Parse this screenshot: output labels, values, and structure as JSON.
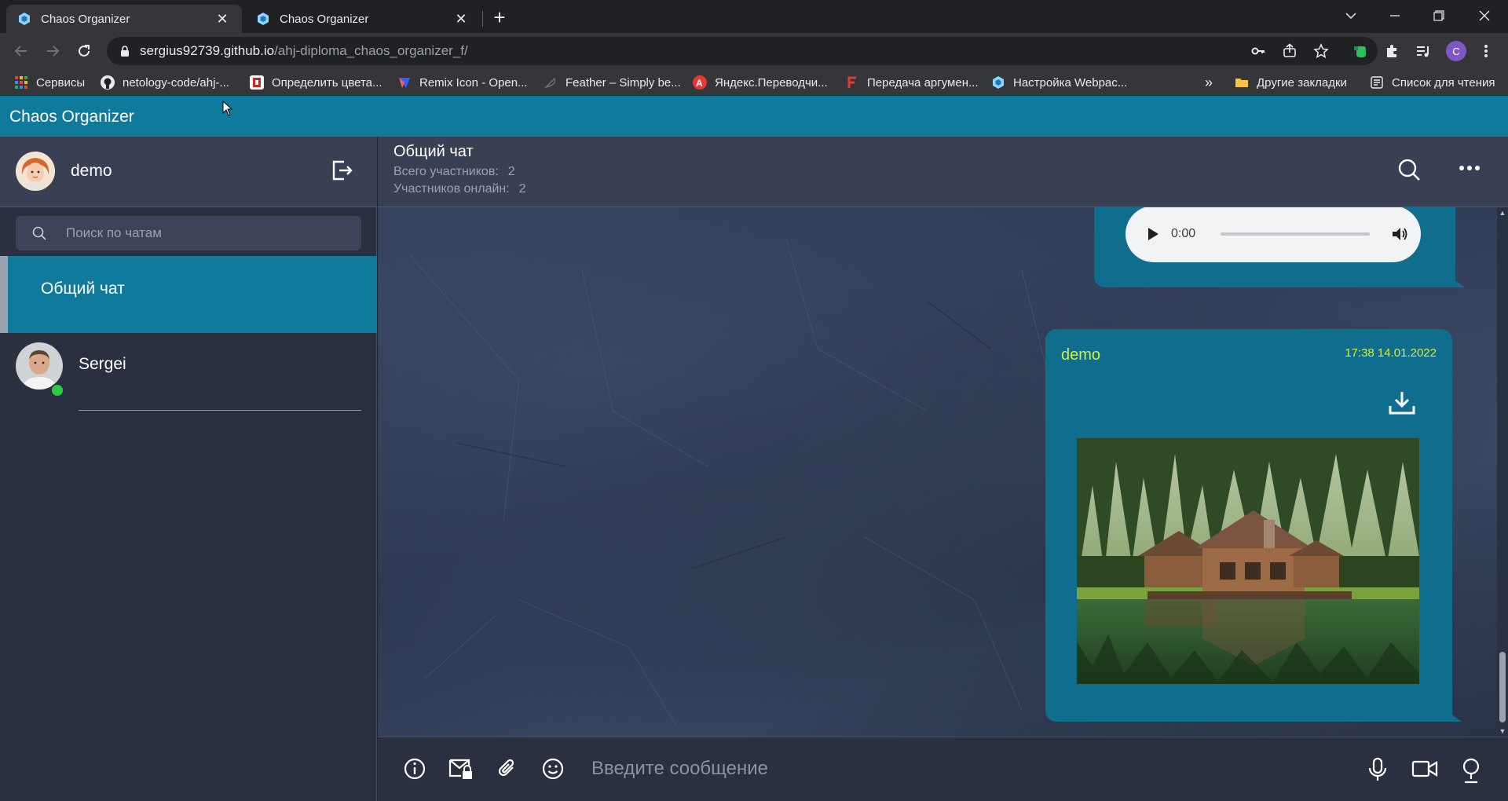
{
  "browser": {
    "tabs": [
      {
        "title": "Chaos Organizer",
        "active": true
      },
      {
        "title": "Chaos Organizer",
        "active": false
      }
    ],
    "url_host": "sergius92739.github.io",
    "url_path": "/ahj-diploma_chaos_organizer_f/",
    "profile_initial": "C",
    "bookmarks": [
      {
        "label": "Сервисы",
        "icon": "apps-grid-icon"
      },
      {
        "label": "netology-code/ahj-...",
        "icon": "github-icon"
      },
      {
        "label": "Определить цвета...",
        "icon": "color-icon"
      },
      {
        "label": "Remix Icon - Open...",
        "icon": "remix-icon"
      },
      {
        "label": "Feather – Simply be...",
        "icon": "feather-icon"
      },
      {
        "label": "Яндекс.Переводчи...",
        "icon": "yandex-translate-icon"
      },
      {
        "label": "Передача аргумен...",
        "icon": "f-icon"
      },
      {
        "label": "Настройка Webpac...",
        "icon": "webpack-icon"
      }
    ],
    "bookmarks_overflow": "»",
    "other_bookmarks": "Другие закладки",
    "reading_list": "Список для чтения"
  },
  "app": {
    "title": "Chaos Organizer",
    "user": {
      "name": "demo"
    },
    "search_placeholder": "Поиск по чатам",
    "chats": [
      {
        "name": "Общий чат",
        "active": true
      },
      {
        "name": "Sergei",
        "online": true
      }
    ],
    "chat_header": {
      "title": "Общий чат",
      "total_label": "Всего участников:",
      "total_value": "2",
      "online_label": "Участников онлайн:",
      "online_value": "2"
    },
    "messages": [
      {
        "type": "audio",
        "time_display": "0:00"
      },
      {
        "type": "image",
        "author": "demo",
        "timestamp": "17:38 14.01.2022"
      }
    ],
    "composer_placeholder": "Введите сообщение"
  },
  "colors": {
    "accent": "#0f7a9b",
    "bubble": "#0f6d8e",
    "author_highlight": "#d4ef3b",
    "online": "#2ecc40"
  }
}
